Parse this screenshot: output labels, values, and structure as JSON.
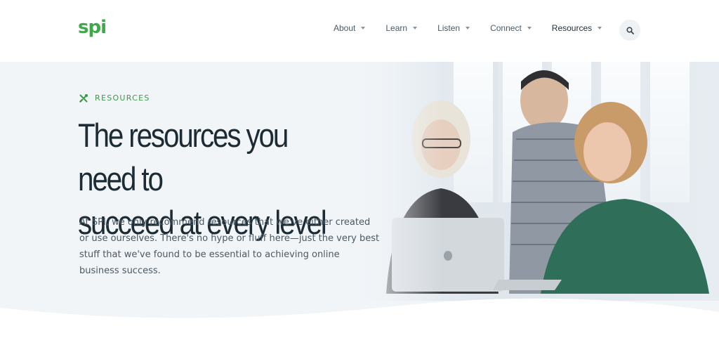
{
  "header": {
    "logo_text": "spi",
    "nav": [
      {
        "label": "About"
      },
      {
        "label": "Learn"
      },
      {
        "label": "Listen"
      },
      {
        "label": "Connect"
      },
      {
        "label": "Resources"
      }
    ],
    "search_icon": "search-icon"
  },
  "hero": {
    "tag_label": "RESOURCES",
    "tag_icon": "tools-icon",
    "headline": "The resources you need to\nsucceed at every level",
    "intro": "At SPI, we only recommend resources that we've either created or use ourselves. There's no hype or fluff here—just the very best stuff that we've found to be essential to achieving online business success."
  },
  "colors": {
    "brand_green": "#3fa84a",
    "hero_bg": "#f2f5f8",
    "heading": "#1d2b35",
    "body_text": "#4a5863"
  }
}
